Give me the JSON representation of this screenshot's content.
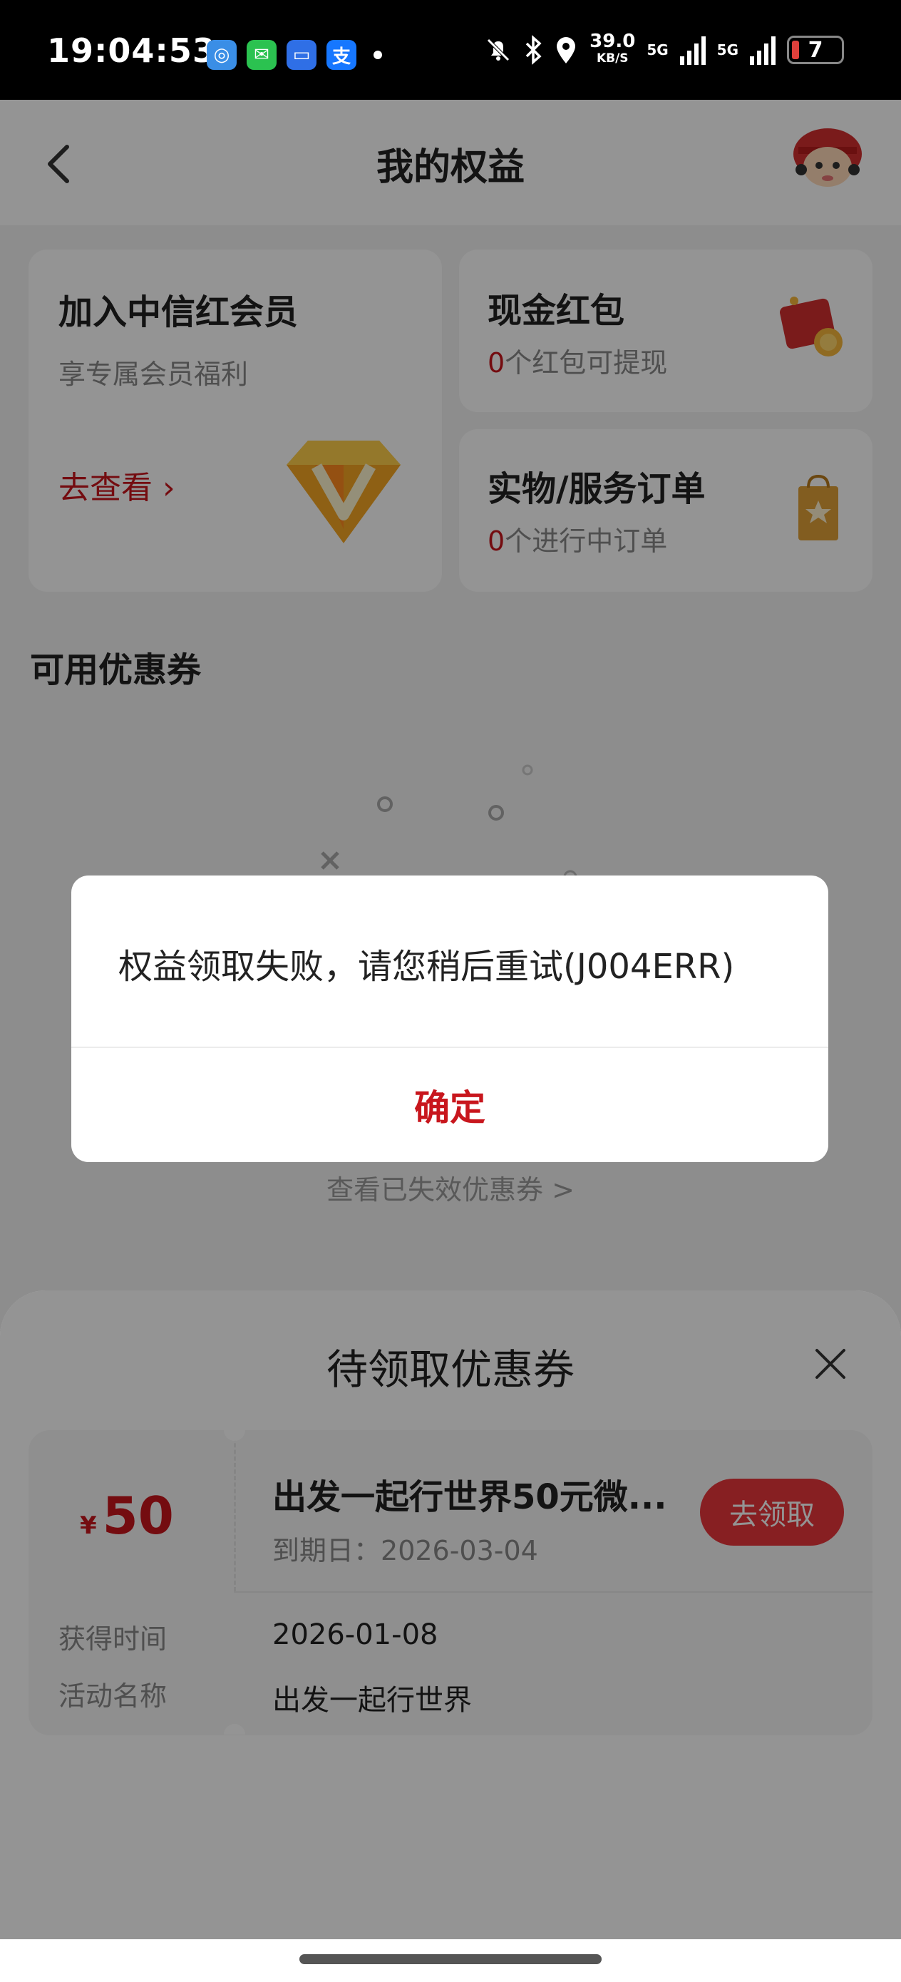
{
  "status_bar": {
    "time": "19:04:53",
    "apps": [
      {
        "icon": "browser-icon",
        "color": "#3a8ee6",
        "glyph": "◎"
      },
      {
        "icon": "wechat-icon",
        "color": "#2bc250",
        "glyph": "✉"
      },
      {
        "icon": "files-icon",
        "color": "#2f6fe6",
        "glyph": "▭"
      },
      {
        "icon": "alipay-icon",
        "color": "#1677ff",
        "glyph": "支"
      }
    ],
    "speed_value": "39.0",
    "speed_unit": "KB/S",
    "net1": "5G",
    "net2": "5G",
    "battery": "7",
    "colors": {
      "background": "#000000",
      "battery_low": "#e0403b"
    }
  },
  "header": {
    "title": "我的权益"
  },
  "cards": {
    "member": {
      "title": "加入中信红会员",
      "subtitle": "享专属会员福利",
      "link": "去查看 ›"
    },
    "cash": {
      "title": "现金红包",
      "count": "0",
      "suffix": "个红包可提现"
    },
    "orders": {
      "title": "实物/服务订单",
      "count": "0",
      "suffix": "个进行中订单"
    }
  },
  "coupons_section": {
    "title": "可用优惠券",
    "expired_link": "查看已失效优惠券 >"
  },
  "sheet": {
    "title": "待领取优惠券",
    "coupon": {
      "currency": "¥",
      "amount": "50",
      "name": "出发一起行世界50元微...",
      "expiry_label": "到期日：",
      "expiry_date": "2026-03-04",
      "claim_label": "去领取",
      "obtained_label": "获得时间",
      "obtained_value": "2026-01-08",
      "activity_label": "活动名称",
      "activity_value": "出发一起行世界"
    }
  },
  "dialog": {
    "message": "权益领取失败，请您稍后重试(J004ERR)",
    "confirm": "确定"
  },
  "theme": {
    "accent_red": "#c8161d",
    "button_red": "#e8363b",
    "page_bg": "#f3f3f3"
  }
}
